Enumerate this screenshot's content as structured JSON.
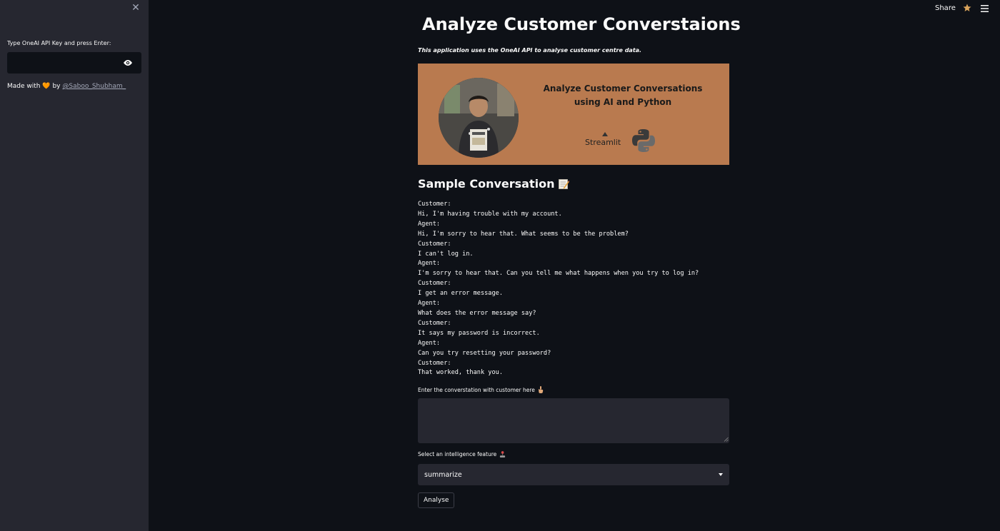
{
  "sidebar": {
    "close_icon": "close-icon",
    "api_key_label": "Type OneAI API Key and press Enter:",
    "api_key_value": "",
    "made_with_prefix": "Made with",
    "made_with_heart": "🧡",
    "made_with_by": "by",
    "author_link": "@Saboo_Shubham_"
  },
  "header": {
    "share_label": "Share",
    "star_icon": "star-icon",
    "menu_icon": "hamburger-menu-icon"
  },
  "main": {
    "title": "Analyze Customer Converstaions",
    "title_icon": "headphones-icon",
    "subtitle": "This application uses the OneAI API to analyse customer centre data.",
    "banner": {
      "heading_line1": "Analyze Customer Conversations",
      "heading_line2": "using AI and Python",
      "streamlit_label": "Streamlit",
      "background_color": "#b97a4f"
    },
    "sample_heading": "Sample Conversation",
    "sample_icon": "memo-icon",
    "conversation_lines": [
      "Customer:",
      "Hi, I'm having trouble with my account.",
      "Agent:",
      "Hi, I'm sorry to hear that. What seems to be the problem?",
      "Customer:",
      "I can't log in.",
      "Agent:",
      "I'm sorry to hear that. Can you tell me what happens when you try to log in?",
      "Customer:",
      "I get an error message.",
      "Agent:",
      "What does the error message say?",
      "Customer:",
      "It says my password is incorrect.",
      "Agent:",
      "Can you try resetting your password?",
      "Customer:",
      "That worked, thank you."
    ],
    "textarea_label": "Enter the converstation with customer here",
    "textarea_label_icon": "pointing-down-icon",
    "textarea_value": "",
    "select_label": "Select an intelligence feature",
    "select_label_icon": "joystick-icon",
    "select_value": "summarize",
    "analyse_button": "Analyse"
  },
  "colors": {
    "background": "#0e1117",
    "sidebar": "#262730",
    "input_background": "#262730",
    "banner": "#b97a4f"
  }
}
